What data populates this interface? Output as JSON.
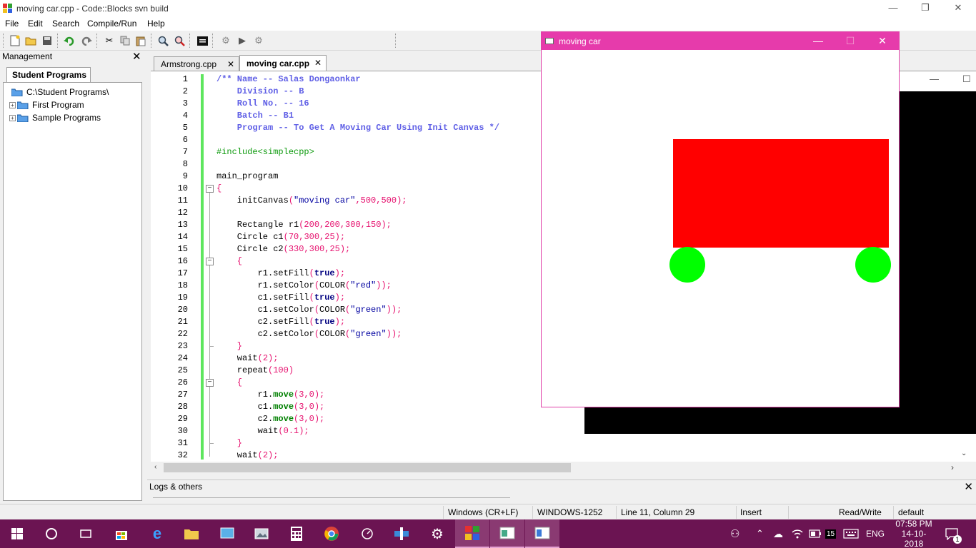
{
  "window": {
    "title": "moving car.cpp - Code::Blocks svn build"
  },
  "menu": [
    "File",
    "Edit",
    "Search",
    "Compile/Run",
    "Help"
  ],
  "management": {
    "header": "Management",
    "tab": "Student Programs",
    "tree": [
      {
        "label": "C:\\Student Programs\\"
      },
      {
        "label": "First Program"
      },
      {
        "label": "Sample Programs"
      }
    ]
  },
  "editor": {
    "tabs": [
      "Armstrong.cpp",
      "moving car.cpp"
    ],
    "active_tab": "moving car.cpp",
    "lines": [
      "1",
      "2",
      "3",
      "4",
      "5",
      "6",
      "7",
      "8",
      "9",
      "10",
      "11",
      "12",
      "13",
      "14",
      "15",
      "16",
      "17",
      "18",
      "19",
      "20",
      "21",
      "22",
      "23",
      "24",
      "25",
      "26",
      "27",
      "28",
      "29",
      "30",
      "31",
      "32"
    ]
  },
  "logs": {
    "header": "Logs & others"
  },
  "status": {
    "eol": "Windows (CR+LF)",
    "encoding": "WINDOWS-1252",
    "position": "Line 11, Column 29",
    "mode": "Insert",
    "access": "Read/Write",
    "profile": "default"
  },
  "car_window": {
    "title": "moving car",
    "body_color": "#ff0000",
    "wheel_color": "#00ff00"
  },
  "taskbar": {
    "badge": "15",
    "language": "ENG",
    "time": "07:58 PM",
    "date": "14-10-2018",
    "notifications": "1",
    "accent": "#6b1452"
  }
}
